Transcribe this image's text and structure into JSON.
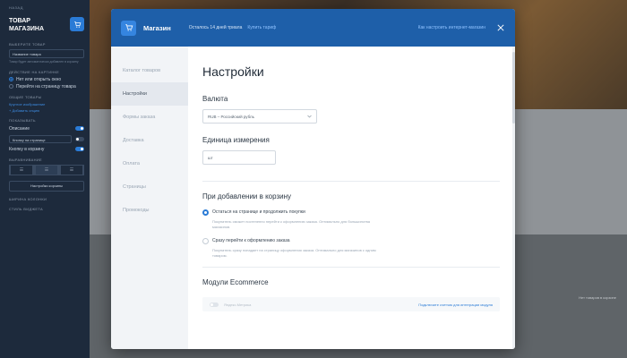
{
  "editor": {
    "back_label": "НАЗАД",
    "title": "ТОВАР МАГАЗИНА",
    "section_choose": "ВЫБЕРИТЕ ТОВАР",
    "product_select": "Название товара",
    "product_hint": "Товар будет автоматически добавлен в корзину",
    "section_action": "ДЕЙСТВИЕ НА КАРТИНКЕ",
    "action_options": [
      "Нет или открыть окно",
      "Перейти на страницу товара"
    ],
    "section_extra": "ОБЩИЕ ТОВАРЫ",
    "extra_link": "Круглое изображение",
    "add_link": "+ Добавить опцию",
    "section_show": "ПОКАЗЫВАТЬ",
    "toggles": [
      {
        "label": "Описание",
        "on": true
      },
      {
        "label": "Кнопку на странице",
        "on": false
      },
      {
        "label": "Кнопку в корзину",
        "on": true
      }
    ],
    "section_align": "ВЫРАВНИВАНИЕ",
    "align_icons": [
      "align-left-icon",
      "align-center-icon",
      "align-right-icon"
    ],
    "wide_button": "Настройки корзины",
    "section_bottom_1": "ШИРИНА КОЛОНКИ",
    "section_bottom_2": "СТИЛЬ ВИДЖЕТА",
    "preview_text": "Нет товаров в корзине"
  },
  "modal": {
    "header": {
      "icon": "cart-icon",
      "title": "Магазин",
      "trial": "Осталось 14 дней триала",
      "buy_link": "Купить тариф",
      "howto_link": "Как настроить интернет-магазин",
      "close_icon": "close-icon"
    },
    "sidebar": {
      "items": [
        "Каталог товаров",
        "Настройки",
        "Формы заказа",
        "Доставка",
        "Оплата",
        "Страницы",
        "Промокоды"
      ],
      "active_index": 1
    },
    "content": {
      "title": "Настройки",
      "currency_label": "Валюта",
      "currency_value": "RUB – Российский рубль",
      "unit_label": "Единица измерения",
      "unit_value": "шт",
      "cart_section_title": "При добавлении в корзину",
      "cart_options": [
        {
          "label": "Остаться на странице и продолжить покупки",
          "desc": "Покупатель сможет постепенно перейти к оформлению заказа. Оптимально для большинства магазинов.",
          "selected": true
        },
        {
          "label": "Сразу перейти к оформлению заказа",
          "desc": "Покупатель сразу попадает на страницу оформления заказа. Оптимально для магазинов с одним товаром.",
          "selected": false
        }
      ],
      "modules_title": "Модули Ecommerce",
      "module": {
        "name": "Яндекс.Метрика",
        "link": "Подключите счетчик для интеграции модуля",
        "on": false
      }
    }
  },
  "colors": {
    "header": "#1e5fa9",
    "accent": "#2a7bd6",
    "editor_bg": "#1d2a3c"
  }
}
